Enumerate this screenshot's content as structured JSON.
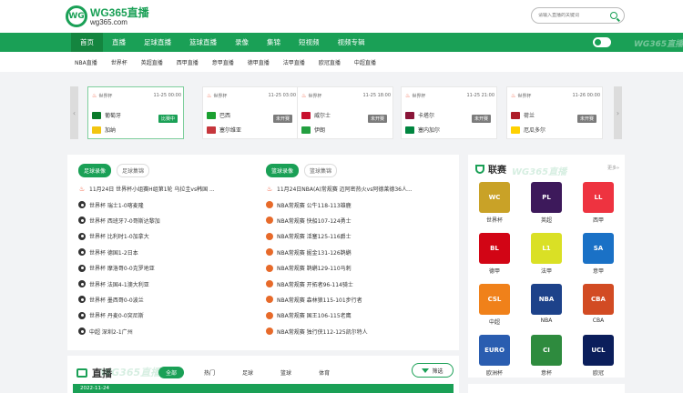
{
  "header": {
    "logo_mark": "WG",
    "logo_main": "WG365直播",
    "logo_sub": "wg365.com",
    "search_placeholder": "请输入直播的关键词"
  },
  "nav": {
    "items": [
      "首页",
      "直播",
      "足球直播",
      "篮球直播",
      "录像",
      "集锦",
      "短视频",
      "视频专辑"
    ],
    "watermark": "WG365直播"
  },
  "subnav": [
    "NBA直播",
    "世界杯",
    "英超直播",
    "西甲直播",
    "意甲直播",
    "德甲直播",
    "法甲直播",
    "欧冠直播",
    "中超直播"
  ],
  "matches": [
    {
      "league": "世界杯",
      "time": "11-25 00:00",
      "home": "葡萄牙",
      "away": "加纳",
      "status": "比赛中",
      "home_color": "#0a7a2a",
      "away_color": "#f2c511"
    },
    {
      "league": "世界杯",
      "time": "11-25 03:00",
      "home": "巴西",
      "away": "塞尔维亚",
      "status": "未开赛",
      "home_color": "#1aa030",
      "away_color": "#c6363c"
    },
    {
      "league": "世界杯",
      "time": "11-25 18:00",
      "home": "威尔士",
      "away": "伊朗",
      "status": "未开赛",
      "home_color": "#c8102e",
      "away_color": "#239f40"
    },
    {
      "league": "世界杯",
      "time": "11-25 21:00",
      "home": "卡塔尔",
      "away": "塞内加尔",
      "status": "未开赛",
      "home_color": "#8a1538",
      "away_color": "#00853f"
    },
    {
      "league": "世界杯",
      "time": "11-26 00:00",
      "home": "荷兰",
      "away": "厄瓜多尔",
      "status": "未开赛",
      "home_color": "#ae1c28",
      "away_color": "#ffd100"
    }
  ],
  "soccer_panel": {
    "tabs": [
      "足球录像",
      "足球集锦"
    ],
    "items": [
      "11月24日 世界杯小组赛H组第1轮 乌拉圭vs韩国 ...",
      "世界杯 瑞士1-0喀麦隆",
      "世界杯 西班牙7-0哥斯达黎加",
      "世界杯 比利时1-0加拿大",
      "世界杯 德国1-2日本",
      "世界杯 摩洛哥0-0克罗地亚",
      "世界杯 法国4-1澳大利亚",
      "世界杯 墨西哥0-0波兰",
      "世界杯 丹麦0-0突尼斯",
      "中超 深圳2-1广州"
    ]
  },
  "basket_panel": {
    "tabs": [
      "篮球录像",
      "篮球集锦"
    ],
    "items": [
      "11月24日NBA(A)常规赛 迈阿密热火vs阿德莱德36人...",
      "NBA常规赛 公牛118-113雄鹿",
      "NBA常规赛 快船107-124勇士",
      "NBA常规赛 活塞125-116爵士",
      "NBA常规赛 掘金131-126鹈鹕",
      "NBA常规赛 鹈鹕129-110马刺",
      "NBA常规赛 开拓者96-114骑士",
      "NBA常规赛 森林狼115-101步行者",
      "NBA常规赛 国王106-115老鹰",
      "NBA常规赛 独行侠112-125凯尔特人"
    ]
  },
  "leagues": {
    "title": "联赛",
    "watermark": "WG365直播",
    "more": "更多»",
    "items": [
      {
        "name": "世界杯",
        "mark": "WC",
        "color": "#c9a227"
      },
      {
        "name": "英超",
        "mark": "PL",
        "color": "#3d195b"
      },
      {
        "name": "西甲",
        "mark": "LL",
        "color": "#ee3340"
      },
      {
        "name": "德甲",
        "mark": "BL",
        "color": "#d20515"
      },
      {
        "name": "法甲",
        "mark": "L1",
        "color": "#dae025"
      },
      {
        "name": "意甲",
        "mark": "SA",
        "color": "#1a71c6"
      },
      {
        "name": "中超",
        "mark": "CSL",
        "color": "#f0811a"
      },
      {
        "name": "NBA",
        "mark": "NBA",
        "color": "#1d428a"
      },
      {
        "name": "CBA",
        "mark": "CBA",
        "color": "#d24b23"
      },
      {
        "name": "欧洲杯",
        "mark": "EURO",
        "color": "#2a5db0"
      },
      {
        "name": "意杯",
        "mark": "CI",
        "color": "#2e8b3e"
      },
      {
        "name": "欧冠",
        "mark": "UCL",
        "color": "#0b1e5b"
      }
    ]
  },
  "live": {
    "title": "直播",
    "watermark": "WG365直播",
    "tabs": [
      "全部",
      "热门",
      "足球",
      "篮球",
      "体育"
    ],
    "filter": "筛选",
    "date": "2022-11-24"
  }
}
